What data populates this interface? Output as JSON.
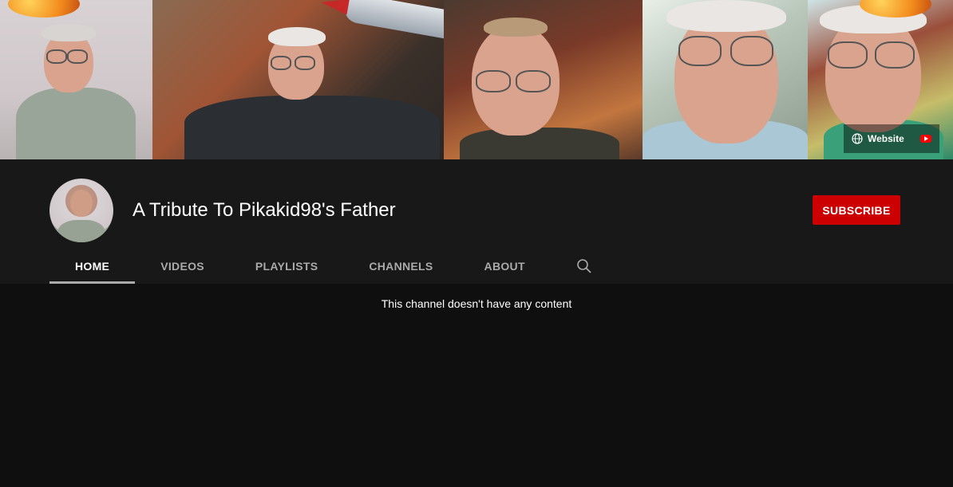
{
  "banner": {
    "website_label": "Website",
    "icons": [
      "globe-icon",
      "youtube-icon"
    ]
  },
  "channel": {
    "name": "A Tribute To Pikakid98's Father",
    "subscribe_label": "SUBSCRIBE"
  },
  "tabs": [
    {
      "label": "HOME",
      "active": true
    },
    {
      "label": "VIDEOS",
      "active": false
    },
    {
      "label": "PLAYLISTS",
      "active": false
    },
    {
      "label": "CHANNELS",
      "active": false
    },
    {
      "label": "ABOUT",
      "active": false
    }
  ],
  "search_icon": "search-icon",
  "content": {
    "empty_message": "This channel doesn't have any content"
  },
  "colors": {
    "subscribe": "#cc0000",
    "background": "#0f0f0f",
    "header": "#181818"
  }
}
